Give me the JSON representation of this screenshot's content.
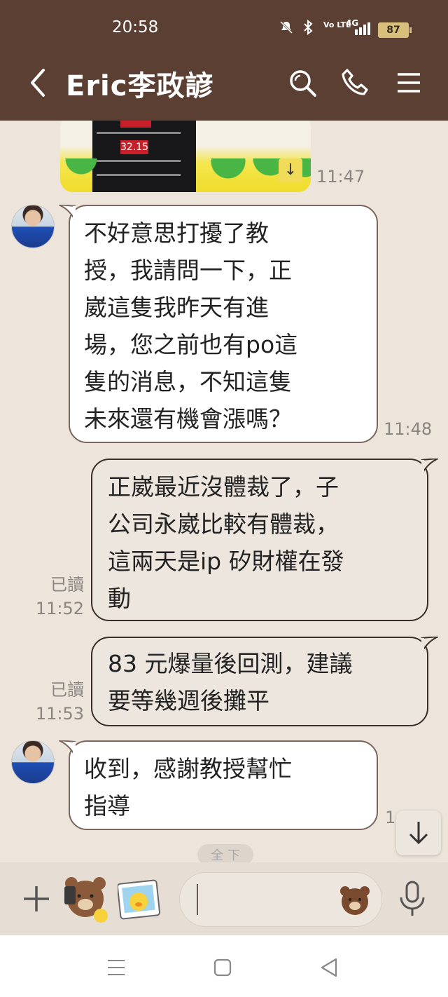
{
  "status_bar": {
    "time": "20:58",
    "network": "4G",
    "volte": "Vo LTE",
    "battery": "87"
  },
  "header": {
    "title": "Eric李政諺"
  },
  "messages": [
    {
      "from": "other",
      "type": "image",
      "time": "11:47",
      "image_text": "32.15"
    },
    {
      "from": "other",
      "type": "text",
      "time": "11:48",
      "text": "不好意思打擾了教\n授，我請問一下，正\n崴這隻我昨天有進\n場，您之前也有po這\n隻的消息，不知這隻\n未來還有機會漲嗎？"
    },
    {
      "from": "me",
      "type": "text",
      "read": "已讀",
      "time": "11:52",
      "text": "正崴最近沒體裁了，子\n公司永崴比較有體裁，\n這兩天是ip 矽財權在發\n動"
    },
    {
      "from": "me",
      "type": "text",
      "read": "已讀",
      "time": "11:53",
      "text": "83 元爆量後回測，建議\n要等幾週後攤平"
    },
    {
      "from": "other",
      "type": "text",
      "time": "1",
      "text": "收到，感謝教授幫忙\n指導"
    }
  ],
  "more_indicator": "全 下",
  "colors": {
    "header_bg": "#5b3f33",
    "chat_bg": "#ede5dc",
    "bubble_border": "#7a665c",
    "my_bubble_bg": "#ece6df"
  }
}
